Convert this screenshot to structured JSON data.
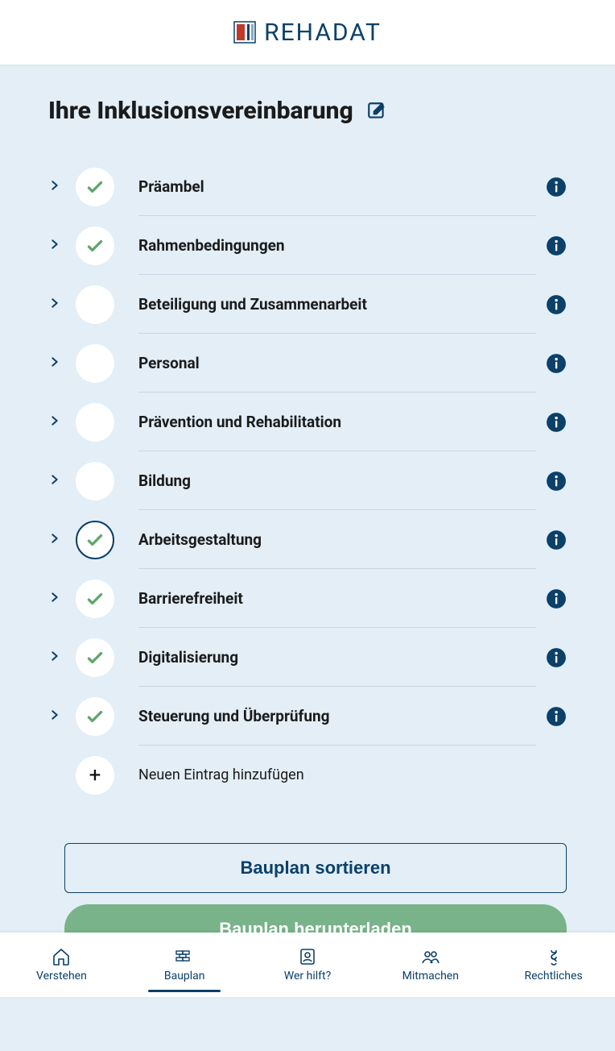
{
  "header": {
    "brand": "REHADAT"
  },
  "page": {
    "title": "Ihre Inklusionsvereinbarung"
  },
  "sections": [
    {
      "label": "Präambel",
      "checked": true,
      "active": false
    },
    {
      "label": "Rahmenbedingungen",
      "checked": true,
      "active": false
    },
    {
      "label": "Beteiligung und Zusammenarbeit",
      "checked": false,
      "active": false
    },
    {
      "label": "Personal",
      "checked": false,
      "active": false
    },
    {
      "label": "Prävention und Rehabilitation",
      "checked": false,
      "active": false
    },
    {
      "label": "Bildung",
      "checked": false,
      "active": false
    },
    {
      "label": "Arbeitsgestaltung",
      "checked": true,
      "active": true
    },
    {
      "label": "Barrierefreiheit",
      "checked": true,
      "active": false
    },
    {
      "label": "Digitalisierung",
      "checked": true,
      "active": false
    },
    {
      "label": "Steuerung und Überprüfung",
      "checked": true,
      "active": false
    }
  ],
  "add_label": "Neuen Eintrag hinzufügen",
  "buttons": {
    "sort": "Bauplan sortieren",
    "download": "Bauplan herunterladen"
  },
  "nav": [
    {
      "label": "Verstehen",
      "icon": "home",
      "active": false
    },
    {
      "label": "Bauplan",
      "icon": "bricks",
      "active": true
    },
    {
      "label": "Wer hilft?",
      "icon": "contact",
      "active": false
    },
    {
      "label": "Mitmachen",
      "icon": "people",
      "active": false
    },
    {
      "label": "Rechtliches",
      "icon": "law",
      "active": false
    }
  ],
  "colors": {
    "primary": "#0b4069",
    "pageBg": "#e3eef7",
    "check": "#5fa66c",
    "download": "#78b389"
  }
}
